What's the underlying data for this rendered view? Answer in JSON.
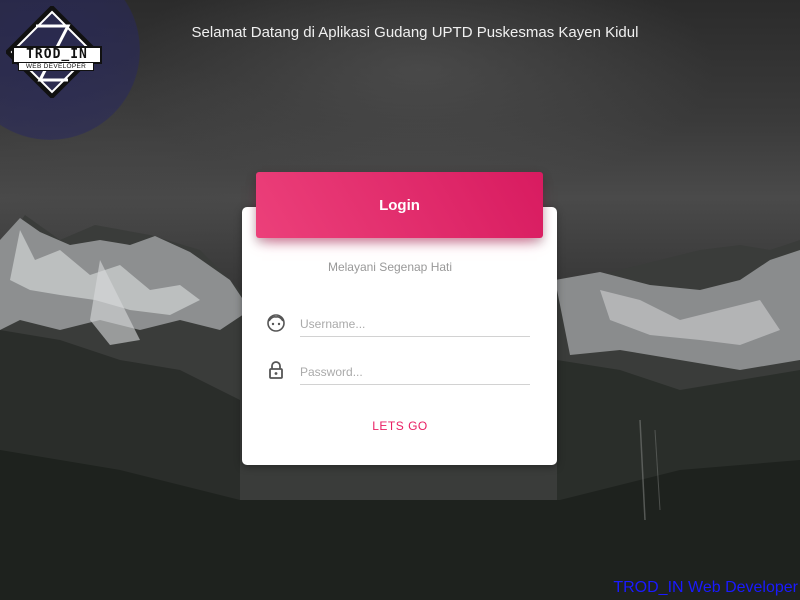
{
  "header": {
    "welcome_text": "Selamat Datang di Aplikasi Gudang UPTD Puskesmas Kayen Kidul"
  },
  "logo": {
    "title": "TROD_IN",
    "subtitle": "WEB DEVELOPER"
  },
  "login_card": {
    "title": "Login",
    "tagline": "Melayani Segenap Hati",
    "username": {
      "placeholder": "Username...",
      "value": "",
      "icon": "face-icon"
    },
    "password": {
      "placeholder": "Password...",
      "value": "",
      "icon": "lock-icon"
    },
    "submit_label": "LETS GO"
  },
  "footer": {
    "watermark": "TROD_IN Web Developer"
  },
  "colors": {
    "accent": "#e91e63",
    "watermark": "#1a1aff"
  }
}
